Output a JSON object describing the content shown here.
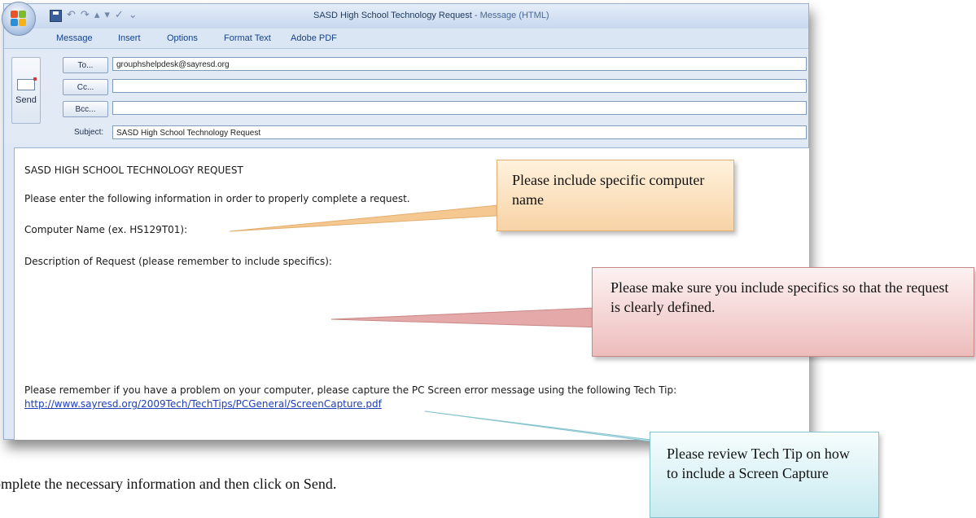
{
  "window": {
    "title": "SASD High School Technology Request",
    "title_suffix": " - Message (HTML)"
  },
  "ribbon": {
    "tabs": [
      "Message",
      "Insert",
      "Options",
      "Format Text",
      "Adobe PDF"
    ]
  },
  "send": {
    "label": "Send"
  },
  "header": {
    "to_button": "To...",
    "cc_button": "Cc...",
    "bcc_button": "Bcc...",
    "to_value": "grouphshelpdesk@sayresd.org",
    "cc_value": "",
    "bcc_value": "",
    "subject_label": "Subject:",
    "subject_value": "SASD High School Technology Request"
  },
  "body": {
    "heading": "SASD HIGH SCHOOL TECHNOLOGY REQUEST",
    "intro": "Please enter the following information in order to properly complete a request.",
    "computer_name": "Computer Name (ex. HS129T01):",
    "description": "Description of Request (please remember to include specifics):",
    "reminder": "Please remember if you have a problem on your computer, please capture the PC Screen error message using the following Tech Tip:",
    "link": "http://www.sayresd.org/2009Tech/TechTips/PCGeneral/ScreenCapture.pdf"
  },
  "callouts": {
    "computer_name": "Please include specific computer name",
    "specifics": "Please make sure you include specifics so that the request is clearly defined.",
    "tech_tip": "Please review Tech Tip on how to include a Screen Capture"
  },
  "footer": {
    "instruction": "omplete the necessary information and then click on Send."
  },
  "colors": {
    "callout_orange": "#f8d3a6",
    "callout_red": "#edbcbc",
    "callout_blue": "#c7eaf0",
    "link": "#1f3fb8"
  }
}
